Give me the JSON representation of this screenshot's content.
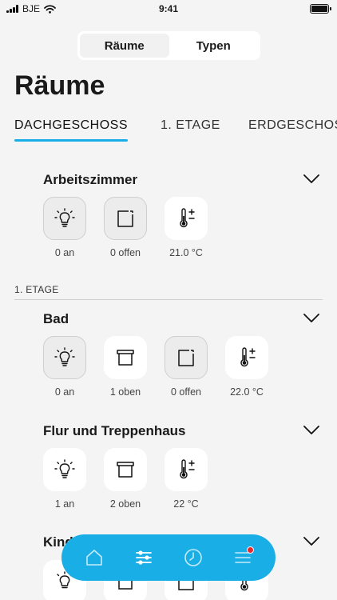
{
  "status": {
    "carrier": "BJE",
    "time": "9:41"
  },
  "segments": [
    "Räume",
    "Typen"
  ],
  "title": "Räume",
  "floor_tabs": [
    "DACHGESCHOSS",
    "1. ETAGE",
    "ERDGESCHOSS"
  ],
  "groups": [
    {
      "label": "",
      "rooms": [
        {
          "name": "Arbeitszimmer",
          "tiles": [
            {
              "icon": "light-bulb-icon",
              "label": "0 an"
            },
            {
              "icon": "window-icon",
              "label": "0 offen"
            },
            {
              "icon": "thermometer-icon",
              "label": "21.0 °C"
            }
          ]
        }
      ]
    },
    {
      "label": "1. ETAGE",
      "rooms": [
        {
          "name": "Bad",
          "tiles": [
            {
              "icon": "light-bulb-icon",
              "label": "0 an"
            },
            {
              "icon": "blind-icon",
              "label": "1 oben"
            },
            {
              "icon": "window-icon",
              "label": "0 offen"
            },
            {
              "icon": "thermometer-icon",
              "label": "22.0 °C"
            }
          ]
        },
        {
          "name": "Flur und Treppenhaus",
          "tiles": [
            {
              "icon": "light-bulb-icon",
              "label": "1 an"
            },
            {
              "icon": "blind-icon",
              "label": "2 oben"
            },
            {
              "icon": "thermometer-icon",
              "label": "22 °C"
            }
          ]
        },
        {
          "name": "Kinderzimmer",
          "tiles": []
        }
      ]
    }
  ],
  "nav": [
    "home-icon",
    "controls-icon",
    "clock-icon",
    "menu-icon"
  ],
  "colors": {
    "accent": "#1aaee6",
    "notification": "#e8262c"
  }
}
